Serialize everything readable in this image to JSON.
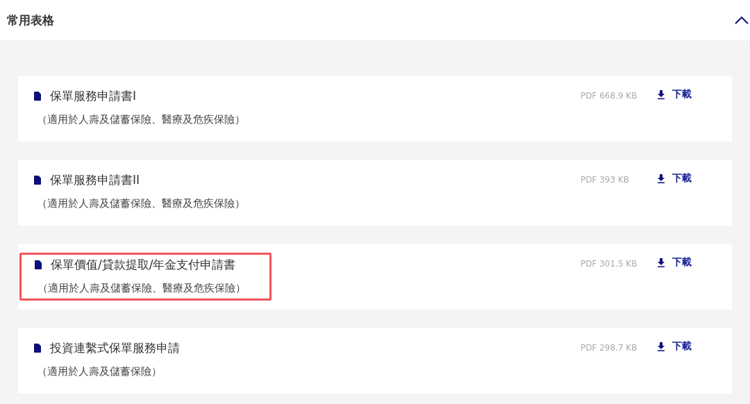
{
  "section": {
    "title": "常用表格",
    "expanded": true
  },
  "forms": [
    {
      "title": "保單服務申請書I",
      "note": "（適用於人壽及儲蓄保險、醫療及危疾保險）",
      "file_info": "PDF 668.9 KB",
      "download": "下載",
      "highlighted": false
    },
    {
      "title": "保單服務申請書II",
      "note": "（適用於人壽及儲蓄保險、醫療及危疾保險）",
      "file_info": "PDF 393 KB",
      "download": "下載",
      "highlighted": false
    },
    {
      "title": "保單價值/貸款提取/年金支付申請書",
      "note": "（適用於人壽及儲蓄保險、醫療及危疾保險）",
      "file_info": "PDF 301.5 KB",
      "download": "下載",
      "highlighted": true
    },
    {
      "title": "投資連繫式保單服務申請",
      "note": "（適用於人壽及儲蓄保險）",
      "file_info": "PDF 298.7 KB",
      "download": "下載",
      "highlighted": false
    }
  ]
}
